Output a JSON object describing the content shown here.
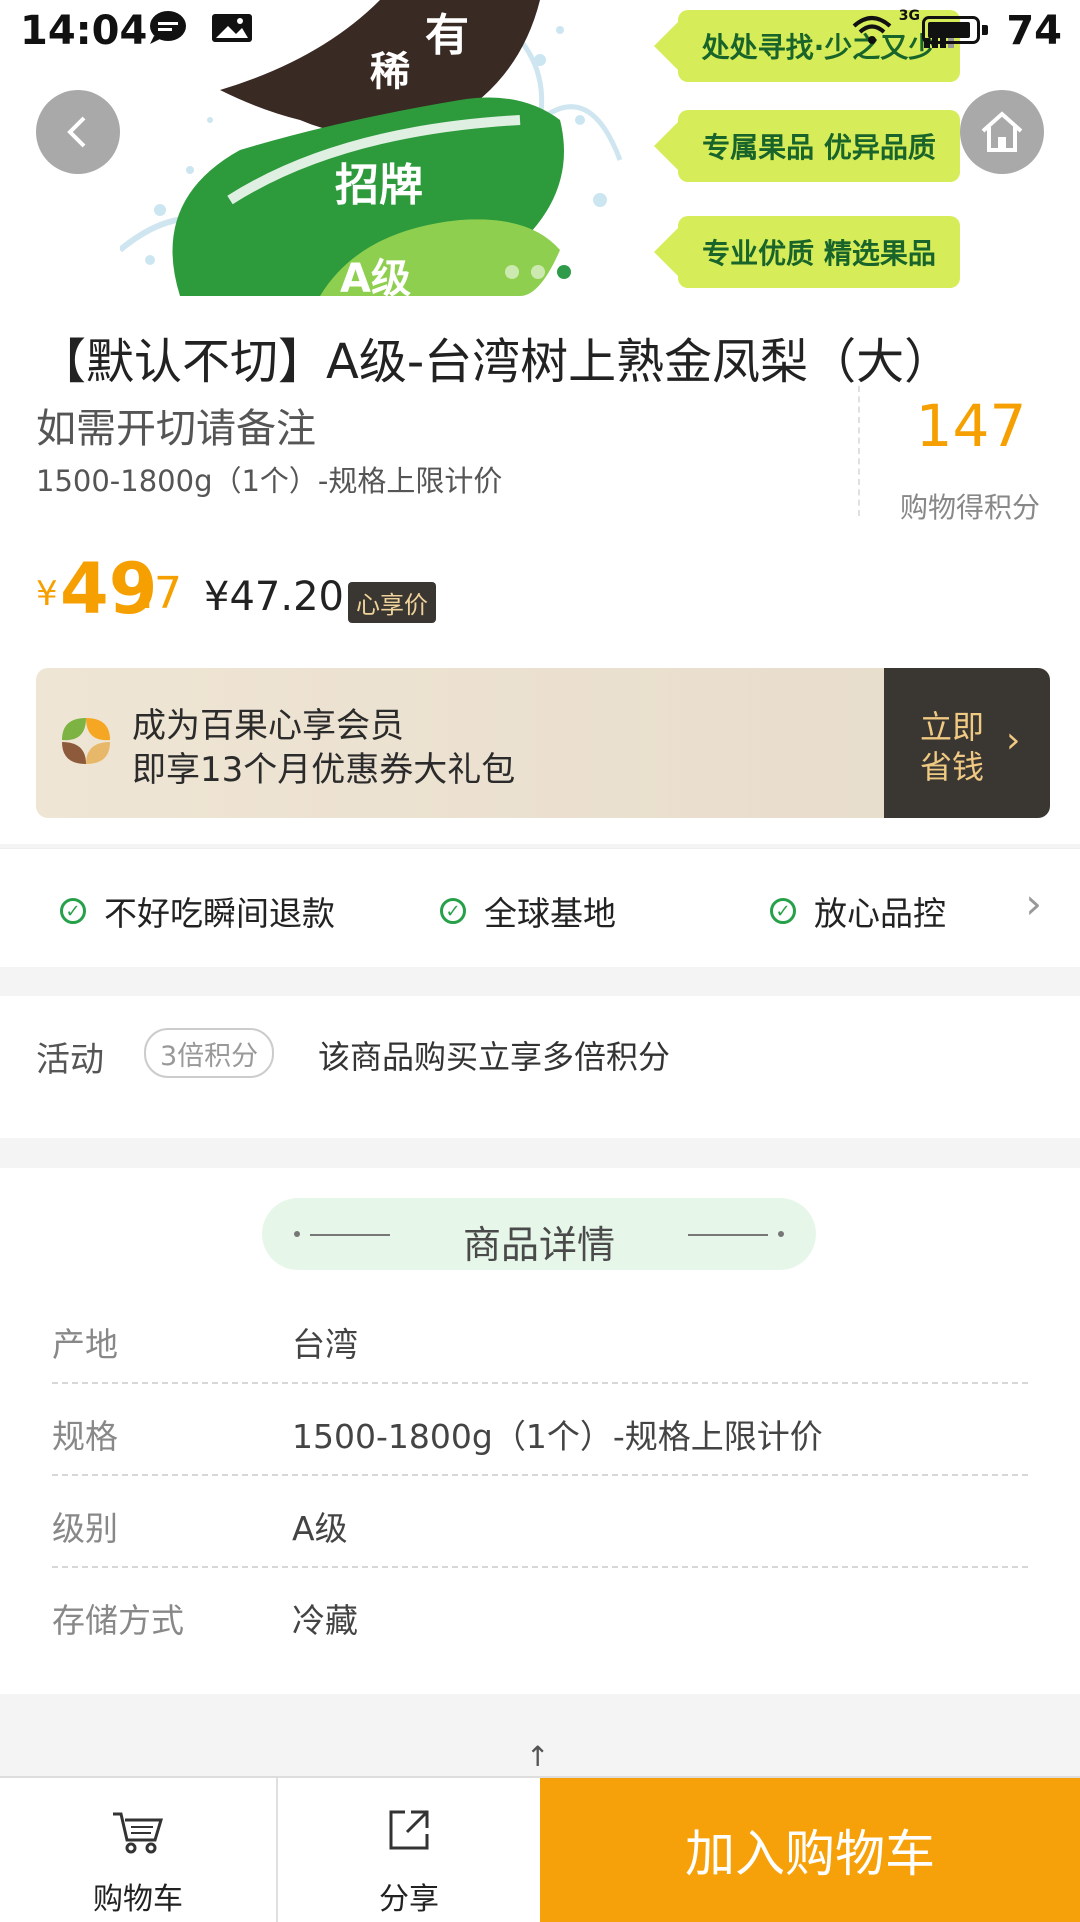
{
  "status_bar": {
    "time": "14:04",
    "network": "3G",
    "battery": "74"
  },
  "banner": {
    "art_text": [
      "有",
      "稀",
      "招牌",
      "A级"
    ],
    "tags": [
      "处处寻找·少之又少",
      "专属果品 优异品质",
      "专业优质 精选果品"
    ],
    "slide_count": 3,
    "active_slide": 3,
    "back_icon": "chevron-left-icon",
    "home_icon": "home-icon"
  },
  "product": {
    "title": "【默认不切】A级-台湾树上熟金凤梨（大）",
    "subtitle": "如需开切请备注",
    "spec": "1500-1800g（1个）-规格上限计价",
    "points_value": "147",
    "points_label": "购物得积分",
    "price_currency": "¥",
    "price_integer": "49",
    "price_decimal": ".7",
    "member_price": "¥47.20",
    "member_tag": "心享价"
  },
  "member_banner": {
    "line1": "成为百果心享会员",
    "line2": "即享13个月优惠券大礼包",
    "cta_line1": "立即",
    "cta_line2": "省钱",
    "accent": "#3a3733"
  },
  "guarantees": [
    "不好吃瞬间退款",
    "全球基地",
    "放心品控"
  ],
  "activity": {
    "label": "活动",
    "tag": "3倍积分",
    "description": "该商品购买立享多倍积分"
  },
  "details": {
    "heading": "商品详情",
    "rows": [
      {
        "label": "产地",
        "value": "台湾"
      },
      {
        "label": "规格",
        "value": "1500-1800g（1个）-规格上限计价"
      },
      {
        "label": "级别",
        "value": "A级"
      },
      {
        "label": "存储方式",
        "value": "冷藏"
      }
    ]
  },
  "bottom_bar": {
    "cart_label": "购物车",
    "share_label": "分享",
    "add_to_cart": "加入购物车",
    "accent": "#f7a10a"
  }
}
